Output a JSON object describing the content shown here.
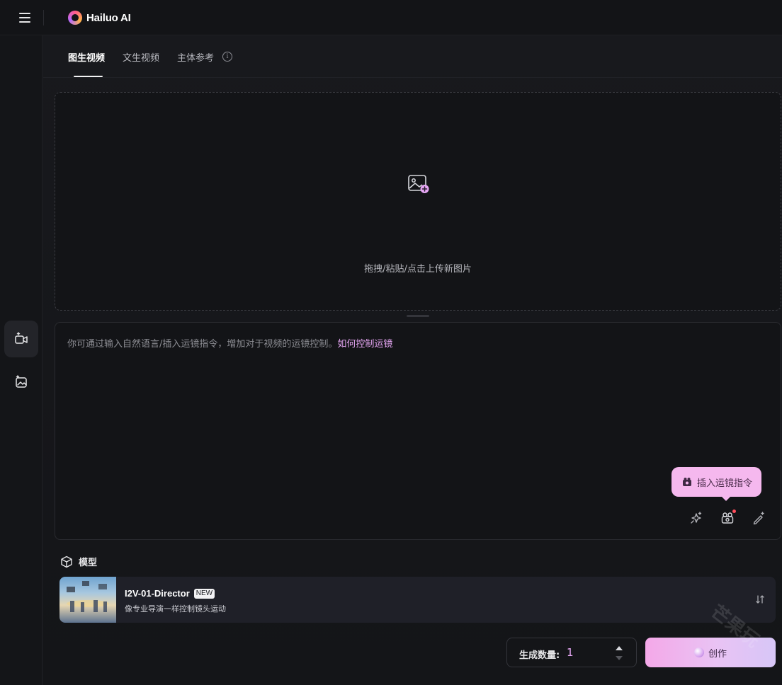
{
  "app": {
    "logo_text": "Hailuo AI"
  },
  "tabs": [
    {
      "label": "图生视频",
      "active": true
    },
    {
      "label": "文生视频",
      "active": false
    },
    {
      "label": "主体参考",
      "active": false
    }
  ],
  "upload": {
    "text": "拖拽/粘贴/点击上传新图片"
  },
  "prompt": {
    "placeholder": "你可通过输入自然语言/插入运镜指令，增加对于视频的运镜控制。",
    "link": "如何控制运镜"
  },
  "tooltip": {
    "label": "插入运镜指令"
  },
  "model_section": {
    "title": "模型",
    "model": {
      "name": "I2V-01-Director",
      "badge": "NEW",
      "description": "像专业导演一样控制镜头运动"
    }
  },
  "generate": {
    "count_label": "生成数量:",
    "count_value": "1",
    "create_label": "创作"
  },
  "watermark": "芒果玩",
  "colors": {
    "accent": "#e7a7f5",
    "tooltip_bg": "#f5b8ee",
    "background": "#141518"
  }
}
